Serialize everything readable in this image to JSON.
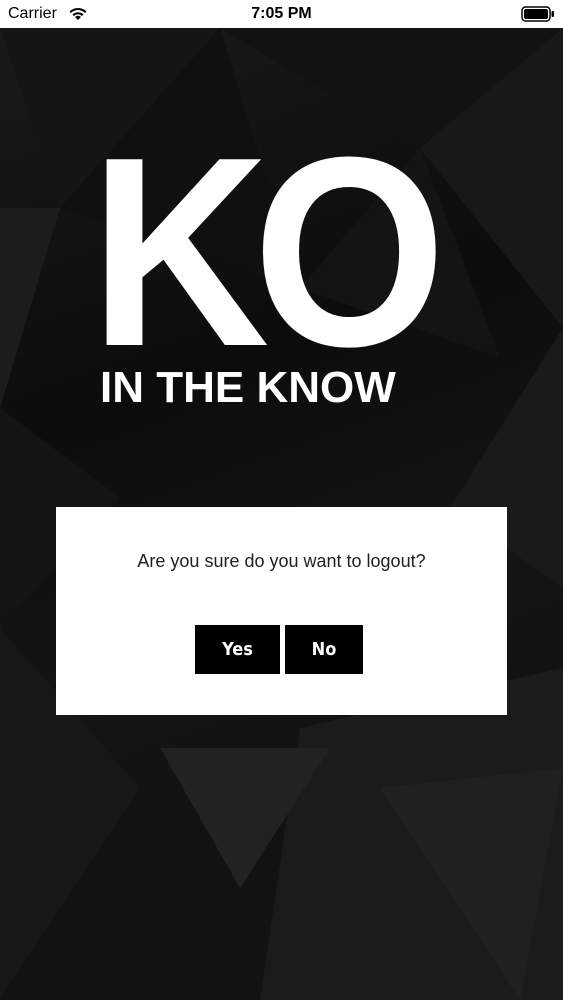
{
  "status_bar": {
    "carrier": "Carrier",
    "time": "7:05 PM",
    "wifi_icon": "wifi-icon",
    "battery_icon": "battery-icon"
  },
  "logo": {
    "main": "KO",
    "tagline": "IN THE KNOW"
  },
  "dialog": {
    "message": "Are you sure do you want to logout?",
    "yes_label": "Yes",
    "no_label": "No"
  },
  "colors": {
    "background": "#0e0e0e",
    "dialog_bg": "#ffffff",
    "button_bg": "#000000",
    "button_text": "#ffffff"
  }
}
